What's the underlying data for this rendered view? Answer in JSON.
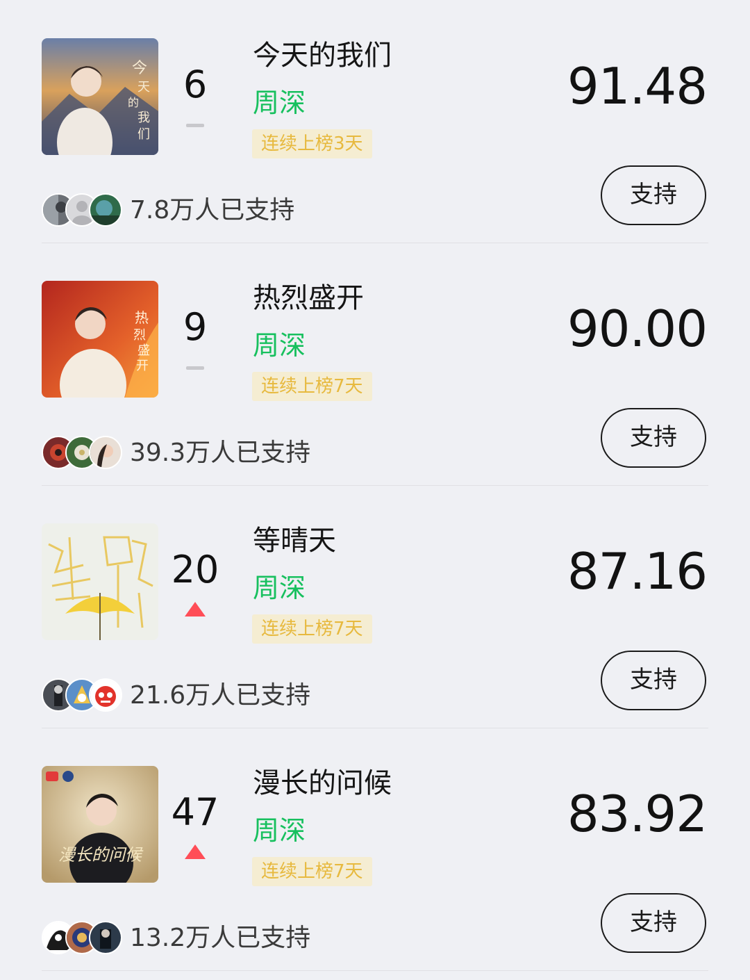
{
  "items": [
    {
      "rank": "6",
      "trend": "flat",
      "title": "今天的我们",
      "artist": "周深",
      "streak": "连续上榜3天",
      "score": "91.48",
      "supporters": "7.8万人已支持",
      "support_label": "支持"
    },
    {
      "rank": "9",
      "trend": "flat",
      "title": "热烈盛开",
      "artist": "周深",
      "streak": "连续上榜7天",
      "score": "90.00",
      "supporters": "39.3万人已支持",
      "support_label": "支持"
    },
    {
      "rank": "20",
      "trend": "up",
      "title": "等晴天",
      "artist": "周深",
      "streak": "连续上榜7天",
      "score": "87.16",
      "supporters": "21.6万人已支持",
      "support_label": "支持"
    },
    {
      "rank": "47",
      "trend": "up",
      "title": "漫长的问候",
      "artist": "周深",
      "streak": "连续上榜7天",
      "score": "83.92",
      "supporters": "13.2万人已支持",
      "support_label": "支持"
    }
  ],
  "colors": {
    "artist": "#17c05e",
    "streak_bg": "#f5edd2",
    "streak_text": "#e7b93e",
    "trend_up": "#ff4d57",
    "trend_flat": "#c8c8cc"
  }
}
